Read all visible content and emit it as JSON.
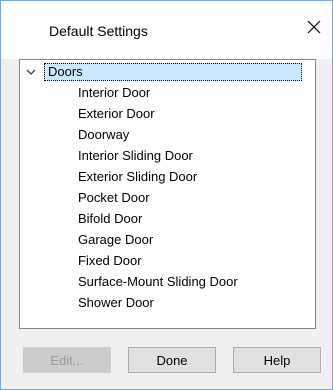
{
  "dialog": {
    "title": "Default Settings",
    "close_glyph": "✕"
  },
  "tree": {
    "root": {
      "label": "Doors",
      "expanded": true
    },
    "children": [
      "Interior Door",
      "Exterior Door",
      "Doorway",
      "Interior Sliding Door",
      "Exterior Sliding Door",
      "Pocket Door",
      "Bifold Door",
      "Garage Door",
      "Fixed Door",
      "Surface-Mount Sliding Door",
      "Shower Door"
    ]
  },
  "buttons": {
    "edit": "Edit...",
    "done": "Done",
    "help": "Help"
  }
}
